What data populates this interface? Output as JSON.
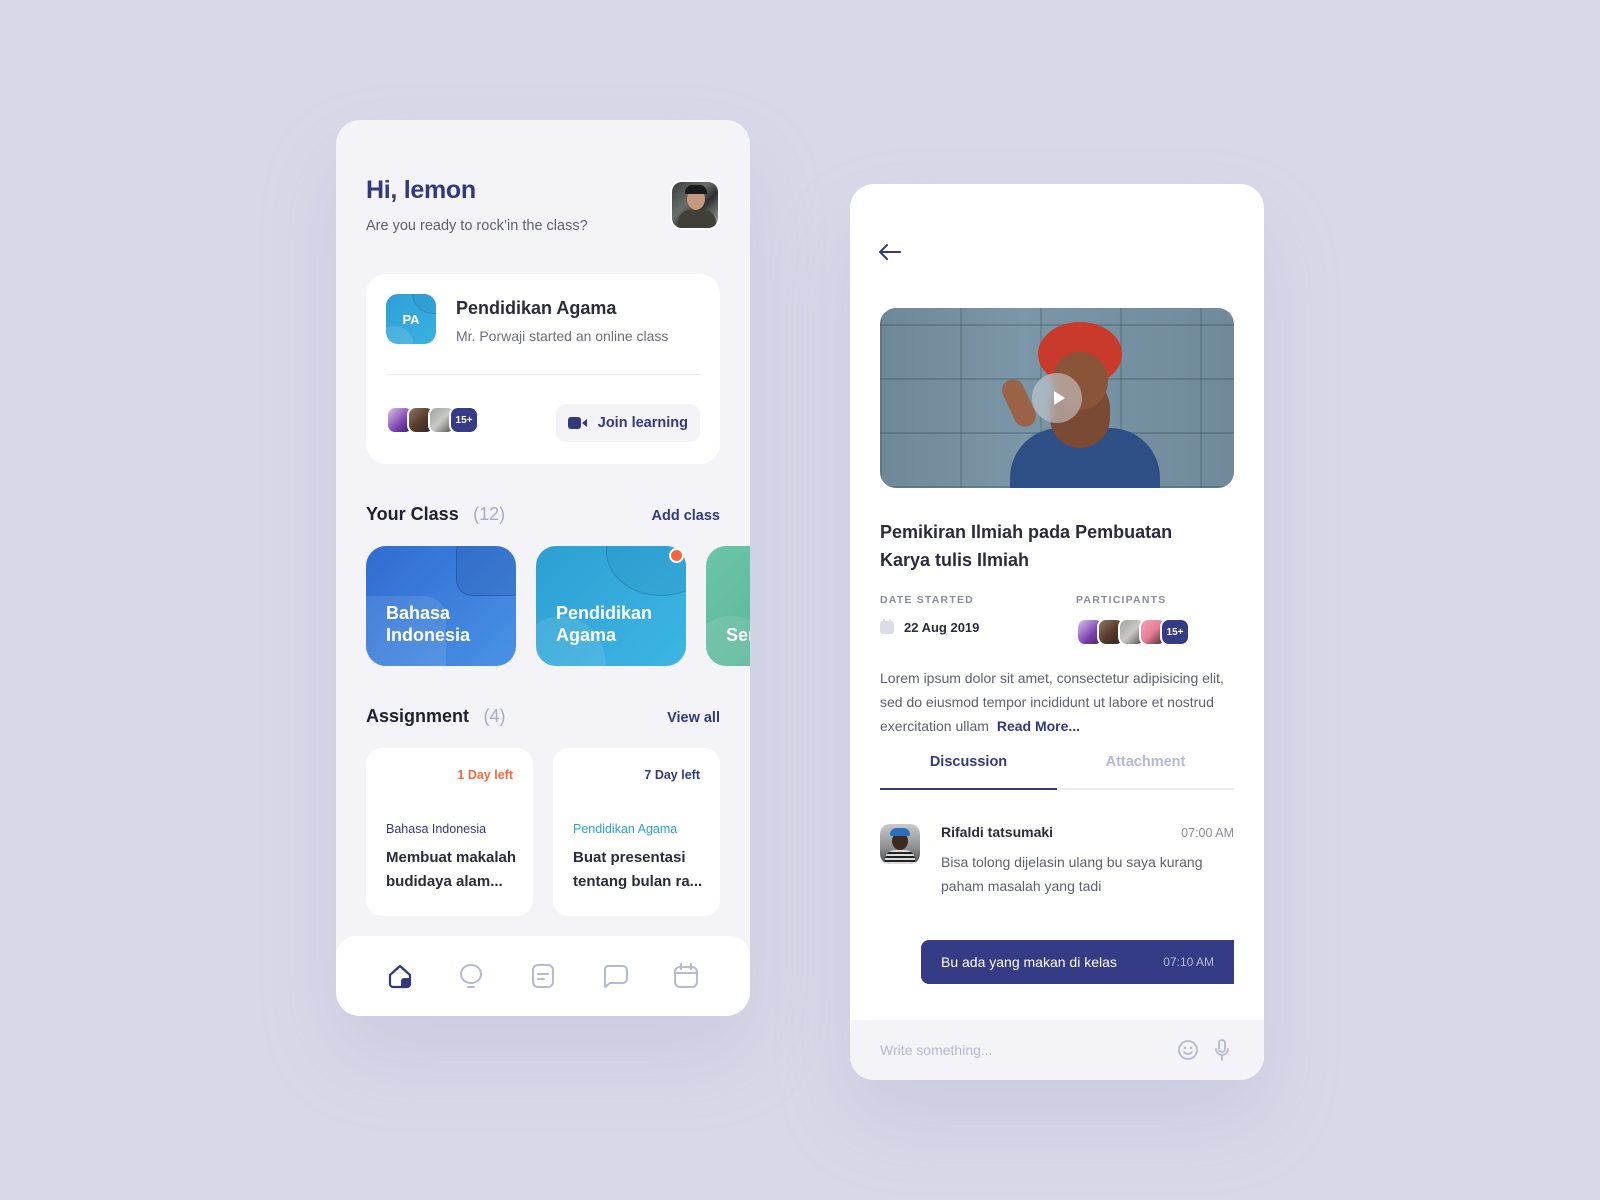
{
  "home": {
    "greeting": "Hi, lemon",
    "subtitle": "Are you ready to rock’in the class?",
    "live_class": {
      "badge": "PA",
      "title": "Pendidikan Agama",
      "subtitle": "Mr. Porwaji started an online class",
      "participants_more": "15+",
      "join_label": "Join learning",
      "join_icon": "video-camera-icon"
    },
    "your_class": {
      "title": "Your Class",
      "count": "(12)",
      "action": "Add class",
      "items": [
        {
          "name": "Bahasa Indonesia",
          "color": "#3a7edc"
        },
        {
          "name": "Pendidikan Agama",
          "color": "#34a8dc",
          "has_notification": true
        },
        {
          "name": "Seni Budaya",
          "color": "#5fbb9c",
          "visible_text": "Se Bu"
        }
      ]
    },
    "assignment": {
      "title": "Assignment",
      "count": "(4)",
      "action": "View all",
      "items": [
        {
          "due": "1 Day left",
          "due_color": "#f4693a",
          "subject": "Bahasa Indonesia",
          "subject_color": "#33397f",
          "task": "Membuat makalah budidaya alam..."
        },
        {
          "due": "7 Day left",
          "due_color": "#33397f",
          "subject": "Pendidikan Agama",
          "subject_color": "#2d9fd3",
          "task": "Buat presentasi tentang bulan ra..."
        }
      ]
    },
    "nav": [
      {
        "name": "home",
        "icon": "home-icon",
        "active": true
      },
      {
        "name": "notifications",
        "icon": "bell-icon",
        "active": false
      },
      {
        "name": "assignments",
        "icon": "document-icon",
        "active": false
      },
      {
        "name": "messages",
        "icon": "chat-icon",
        "active": false
      },
      {
        "name": "calendar",
        "icon": "calendar-icon",
        "active": false
      }
    ]
  },
  "detail": {
    "back_icon": "arrow-left-icon",
    "video_play_icon": "play-icon",
    "title": "Pemikiran Ilmiah pada Pembuatan\nKarya  tulis Ilmiah",
    "date_label": "DATE STARTED",
    "date_value": "22 Aug 2019",
    "participants_label": "PARTICIPANTS",
    "participants_more": "15+",
    "description": "Lorem ipsum dolor sit amet, consectetur adipisicing elit, sed do eiusmod tempor incididunt ut labore et nostrud exercitation ullam",
    "read_more": "Read More...",
    "tabs": [
      {
        "label": "Discussion",
        "active": true
      },
      {
        "label": "Attachment",
        "active": false
      }
    ],
    "comments": [
      {
        "author": "Rifaldi tatsumaki",
        "time": "07:00 AM",
        "text": "Bisa tolong dijelasin ulang bu saya kurang paham masalah yang tadi"
      }
    ],
    "my_message": {
      "text": "Bu ada yang makan di kelas",
      "time": "07:10 AM"
    },
    "composer": {
      "placeholder": "Write something...",
      "emoji_icon": "smiley-icon",
      "mic_icon": "microphone-icon"
    }
  },
  "colors": {
    "primary": "#33397f",
    "accent_orange": "#f4693a",
    "background": "#d8d9e8",
    "surface": "#f3f3f8"
  }
}
